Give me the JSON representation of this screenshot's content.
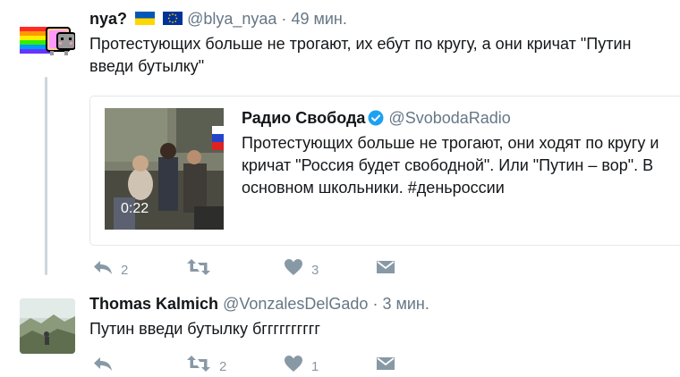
{
  "tweets": [
    {
      "name": "nya?",
      "handle": "@blya_nyaa",
      "separator": "·",
      "time": "49 мин.",
      "text": "Протестующих больше не трогают, их ебут по кругу, а они кричат \"Путин введи бутылку\"",
      "quote": {
        "name": "Радио Свобода",
        "handle": "@SvobodaRadio",
        "text": "Протестующих больше не трогают, они ходят по кругу и кричат \"Россия будет свободной\". Или \"Путин – вор\". В основном школьники. #деньроссии",
        "video_duration": "0:22"
      },
      "actions": {
        "reply_count": "2",
        "retweet_count": "",
        "like_count": "3"
      }
    },
    {
      "name": "Thomas Kalmich",
      "handle": "@VonzalesDelGado",
      "separator": "·",
      "time": "3 мин.",
      "text": "Путин введи бутылку бгггггггггг",
      "actions": {
        "reply_count": "",
        "retweet_count": "2",
        "like_count": "1"
      }
    }
  ],
  "colors": {
    "text": "#14171a",
    "muted": "#657786",
    "action": "#8899a6",
    "border": "#e1e8ed",
    "verified": "#1da1f2"
  }
}
